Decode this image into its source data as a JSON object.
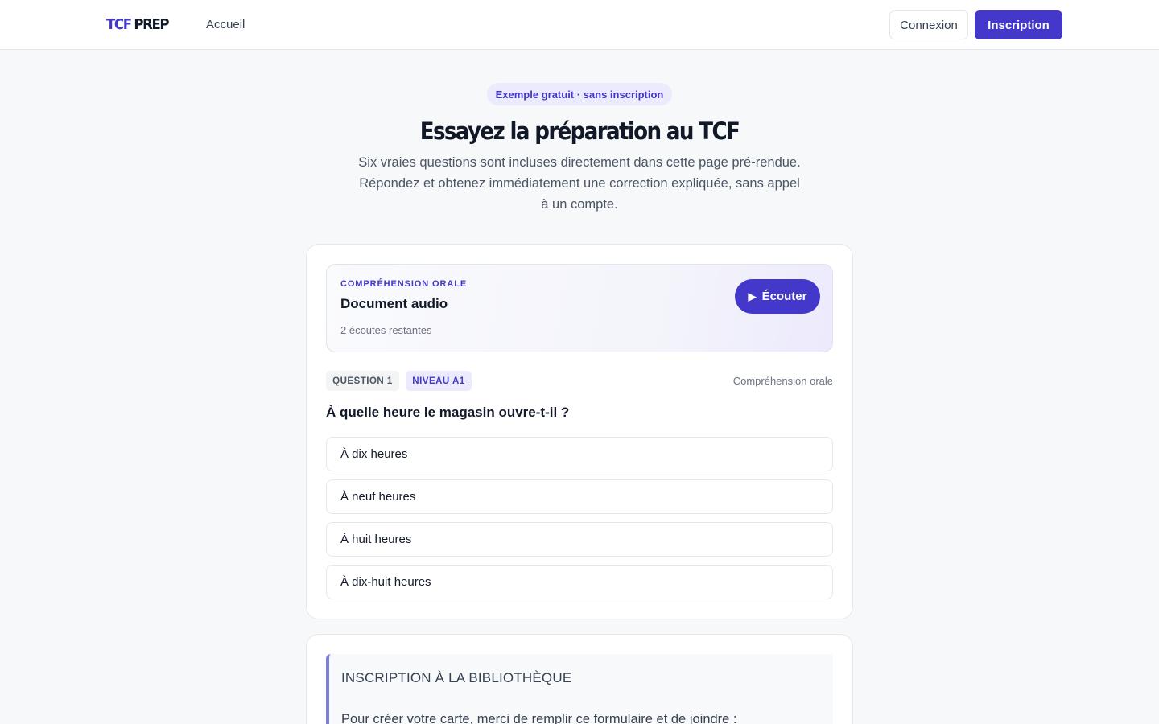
{
  "header": {
    "logo_part1": "TCF",
    "logo_part2": "PREP",
    "nav_home": "Accueil",
    "login_label": "Connexion",
    "signup_label": "Inscription"
  },
  "hero": {
    "badge": "Exemple gratuit · sans inscription",
    "title": "Essayez la préparation au TCF",
    "subtitle": "Six vraies questions sont incluses directement dans cette page pré-rendue. Répondez et obtenez immédiatement une correction expliquée, sans appel à un compte."
  },
  "question_card": {
    "audio": {
      "category": "COMPRÉHENSION ORALE",
      "title": "Document audio",
      "remaining": "2 écoutes restantes",
      "listen_label": "Écouter",
      "play_icon": "▶"
    },
    "question_tag": "QUESTION 1",
    "level_tag": "NIVEAU A1",
    "skill": "Compréhension orale",
    "question": "À quelle heure le magasin ouvre-t-il ?",
    "options": [
      "À dix heures",
      "À neuf heures",
      "À huit heures",
      "À dix-huit heures"
    ]
  },
  "next_card": {
    "doc_title": "INSCRIPTION À LA BIBLIOTHÈQUE",
    "doc_body": "Pour créer votre carte, merci de remplir ce formulaire et de joindre :"
  },
  "colors": {
    "accent": "#4338ca",
    "accent_soft": "#eceafd",
    "background": "#f7f8fa"
  }
}
